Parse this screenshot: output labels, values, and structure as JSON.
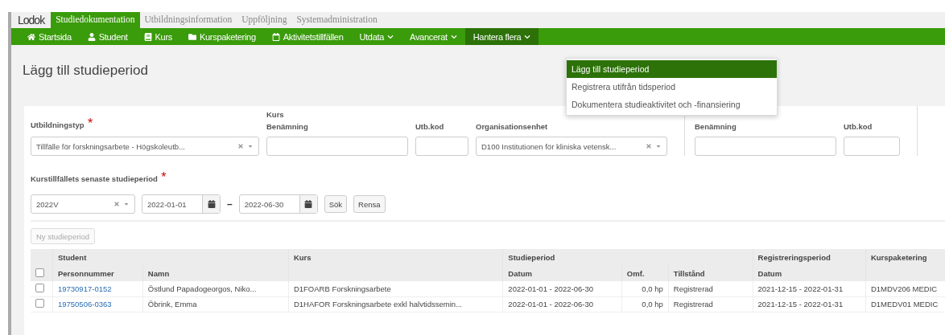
{
  "logo": "Lodok",
  "modules": [
    {
      "label": "Studiedokumentation",
      "selected": true
    },
    {
      "label": "Utbildningsinformation",
      "selected": false
    },
    {
      "label": "Uppföljning",
      "selected": false
    },
    {
      "label": "Systemadministration",
      "selected": false
    }
  ],
  "menu": [
    {
      "label": "Startsida",
      "kind": "home",
      "dropdown": false,
      "open": false
    },
    {
      "label": "Student",
      "kind": "user",
      "dropdown": false,
      "open": false
    },
    {
      "label": "Kurs",
      "kind": "book",
      "dropdown": false,
      "open": false
    },
    {
      "label": "Kurspaketering",
      "kind": "folder",
      "dropdown": false,
      "open": false
    },
    {
      "label": "Aktivitetstillfällen",
      "kind": "calendar",
      "dropdown": false,
      "open": false
    },
    {
      "label": "Utdata",
      "kind": "none",
      "dropdown": true,
      "open": false
    },
    {
      "label": "Avancerat",
      "kind": "none",
      "dropdown": true,
      "open": false
    },
    {
      "label": "Hantera flera",
      "kind": "none",
      "dropdown": true,
      "open": true
    }
  ],
  "dropdown_menu": [
    {
      "label": "Lägg till studieperiod",
      "selected": true
    },
    {
      "label": "Registrera utifrån tidsperiod",
      "selected": false
    },
    {
      "label": "Dokumentera studieaktivitet och -finansiering",
      "selected": false
    }
  ],
  "page_title": "Lägg till studieperiod",
  "filters": {
    "utbildningstyp": {
      "label": "Utbildningstyp",
      "required_mark": "*",
      "value": "Tillfälle för forskningsarbete - Högskoleutb..."
    },
    "kurs_group": "Kurs",
    "kurs_benamning": {
      "label": "Benämning"
    },
    "kurs_utbkod": {
      "label": "Utb.kod"
    },
    "organisationsenhet": {
      "label": "Organisationsenhet",
      "value": "D100 Institutionen för kliniska vetensk..."
    },
    "group_2_benamning": {
      "label": "Benämning"
    },
    "group_2_utbkod": {
      "label": "Utb.kod"
    },
    "period": {
      "label": "Kurstillfällets senaste studieperiod",
      "required_mark": "*",
      "value": "2022V"
    },
    "date_from": "2022-01-01",
    "date_sep": "–",
    "date_to": "2022-06-30",
    "buttons": [
      "Sök",
      "Rensa"
    ]
  },
  "new_button": {
    "label": "Ny studieperiod",
    "disabled": true
  },
  "table": {
    "select_all_checked": false,
    "groups": [
      "Student",
      "Kurs",
      "Studieperiod",
      "Registreringsperiod",
      "Kurspaketering"
    ],
    "columns": [
      "Personnummer",
      "Namn",
      "",
      "Datum",
      "Omf.",
      "Tillstånd",
      "Datum",
      ""
    ],
    "rows": [
      {
        "checked": false,
        "cells": [
          "19730917-0152",
          "Östlund Papadogeorgos, Niko...",
          "D1FOARB Forskningsarbete",
          "2022-01-01 - 2022-06-30",
          "0,0 hp",
          "Registrerad",
          "2021-12-15 - 2022-01-31",
          "D1MDV206 MEDIC"
        ]
      },
      {
        "checked": false,
        "cells": [
          "19750506-0363",
          "Öbrink, Emma",
          "D1HAFOR Forskningsarbete exkl halvtidssemin...",
          "2022-01-01 - 2022-06-30",
          "0,0 hp",
          "Registrerad",
          "2021-12-15 - 2022-01-31",
          "D1MEDV01 MEDIC"
        ]
      }
    ]
  }
}
